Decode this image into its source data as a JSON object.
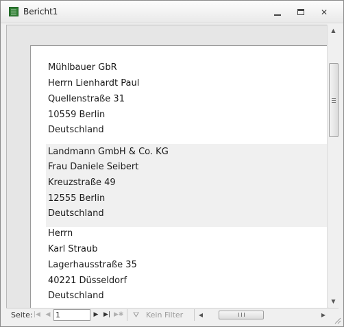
{
  "window": {
    "title": "Bericht1"
  },
  "records": [
    {
      "lines": [
        "Mühlbauer GbR",
        "Herrn Lienhardt Paul",
        "Quellenstraße 31",
        "10559 Berlin",
        "Deutschland"
      ]
    },
    {
      "lines": [
        "Landmann GmbH & Co. KG",
        "Frau Daniele Seibert",
        "Kreuzstraße 49",
        "12555 Berlin",
        "Deutschland"
      ]
    },
    {
      "lines": [
        "Herrn",
        "Karl Straub",
        "Lagerhausstraße 35",
        "40221 Düsseldorf",
        "Deutschland"
      ]
    }
  ],
  "statusbar": {
    "page_label": "Seite:",
    "page_value": "1",
    "filter_label": "Kein Filter"
  },
  "colors": {
    "alt_row": "#f0f0f0",
    "icon_green": "#2e7d32"
  }
}
